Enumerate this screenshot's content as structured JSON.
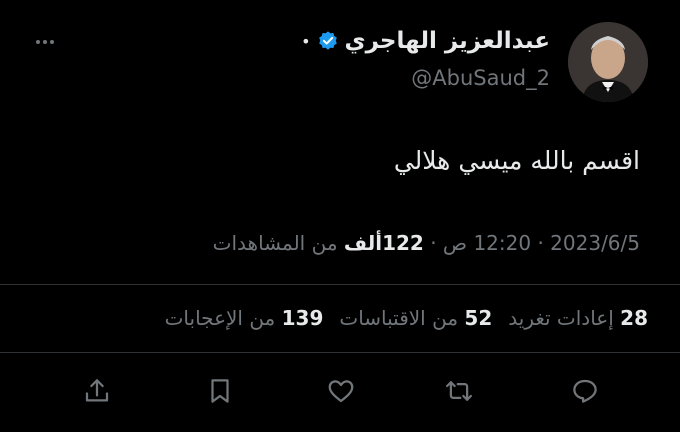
{
  "user": {
    "name": "عبدالعزيز الهاجري",
    "separator": "•",
    "handle": "@AbuSaud_2"
  },
  "tweet": {
    "text": "اقسم بالله ميسي هلالي"
  },
  "meta": {
    "date": "2023/6/5",
    "sep1": "·",
    "time": "12:20 ص",
    "sep2": "·",
    "views_count": "122ألف",
    "views_label": "من المشاهدات"
  },
  "stats": {
    "retweets_count": "28",
    "retweets_label": "إعادات تغريد",
    "quotes_count": "52",
    "quotes_label": "من الاقتباسات",
    "likes_count": "139",
    "likes_label": "من الإعجابات"
  },
  "actions": {
    "reply": "reply-icon",
    "retweet": "retweet-icon",
    "like": "heart-icon",
    "bookmark": "bookmark-icon",
    "share": "share-icon"
  },
  "colors": {
    "background": "#000000",
    "text_primary": "#e7e9ea",
    "text_secondary": "#71767b",
    "verified": "#1d9bf0",
    "divider": "#2f3336"
  }
}
